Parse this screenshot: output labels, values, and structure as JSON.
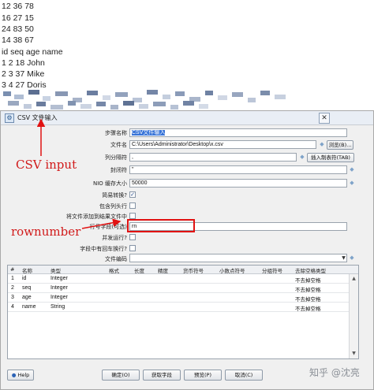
{
  "top_lines": [
    "12  36  78",
    "16  27  15",
    "24  83  50",
    "14  38  67",
    "id  seq age name",
    "1   2   18  John",
    "2   3   37  Mike",
    "3   4   27  Doris"
  ],
  "dialog": {
    "title": "CSV 文件输入",
    "close_label": "✕",
    "fields": {
      "step_name": {
        "label": "步骤名称",
        "value": "CSV文件输入"
      },
      "filename": {
        "label": "文件名",
        "value": "C:\\Users\\Administrator\\Desktop\\x.csv"
      },
      "delimiter": {
        "label": "列分隔符",
        "value": ","
      },
      "enclosure": {
        "label": "封闭符",
        "value": "\""
      },
      "nio_buffer": {
        "label": "NIO 缓存大小",
        "value": "50000"
      },
      "lazy_conversion": {
        "label": "简易转换?",
        "checked": true
      },
      "header_row": {
        "label": "包含列头行",
        "checked": false
      },
      "add_filename": {
        "label": "将文件添加到结果文件中",
        "checked": false
      },
      "rownum_field": {
        "label": "行号字段(可选)",
        "value": "rn"
      },
      "parallel": {
        "label": "并发运行?",
        "checked": false
      },
      "newline_in_field": {
        "label": "字段中有回车换行?",
        "checked": false
      },
      "encoding": {
        "label": "文件编码",
        "value": ""
      }
    },
    "buttons": {
      "browse": "浏览(B)...",
      "insert_tab": "插入制表符(TAB)",
      "help": "Help",
      "ok": "确定(O)",
      "get_fields": "获取字段",
      "preview": "预览(P)",
      "cancel": "取消(C)"
    },
    "table": {
      "columns": [
        "#",
        "名称",
        "类型",
        "格式",
        "长度",
        "精度",
        "货币符号",
        "小数点符号",
        "分组符号",
        "去除空格类型"
      ],
      "rows": [
        {
          "num": "1",
          "name": "id",
          "type": "Integer",
          "trim": "不去掉空格"
        },
        {
          "num": "2",
          "name": "seq",
          "type": "Integer",
          "trim": "不去掉空格"
        },
        {
          "num": "3",
          "name": "age",
          "type": "Integer",
          "trim": "不去掉空格"
        },
        {
          "num": "4",
          "name": "name",
          "type": "String",
          "trim": "不去掉空格"
        }
      ]
    }
  },
  "annotations": {
    "csv_input": "CSV input",
    "rownumber": "rownumber"
  },
  "watermark": "知乎 @沈亮",
  "colors": {
    "annotation_red": "#e11212",
    "selection_blue": "#3874d8"
  }
}
